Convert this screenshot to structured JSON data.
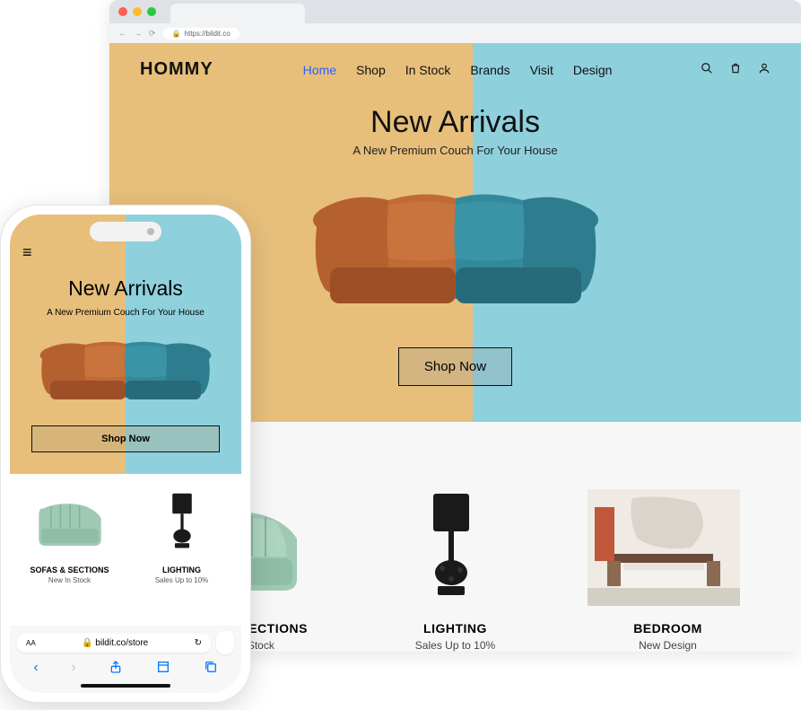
{
  "browser": {
    "url": "https://bildit.co"
  },
  "site": {
    "logo": "HOMMY",
    "nav": [
      "Home",
      "Shop",
      "In Stock",
      "Brands",
      "Visit",
      "Design"
    ],
    "hero_title": "New Arrivals",
    "hero_sub": "A New Premium Couch For Your House",
    "cta": "Shop Now",
    "categories": [
      {
        "title": "SOFAS & SECTIONS",
        "sub": "New In Stock"
      },
      {
        "title": "LIGHTING",
        "sub": "Sales Up to 10%"
      },
      {
        "title": "BEDROOM",
        "sub": "New Design"
      }
    ]
  },
  "mobile": {
    "hero_title": "New Arrivals",
    "hero_sub": "A New Premium Couch For Your House",
    "cta": "Shop Now",
    "categories": [
      {
        "title": "SOFAS & SECTIONS",
        "sub": "New In Stock"
      },
      {
        "title": "LIGHTING",
        "sub": "Sales Up to 10%"
      }
    ],
    "url": "bildit.co/store",
    "url_prefix": "AA"
  }
}
